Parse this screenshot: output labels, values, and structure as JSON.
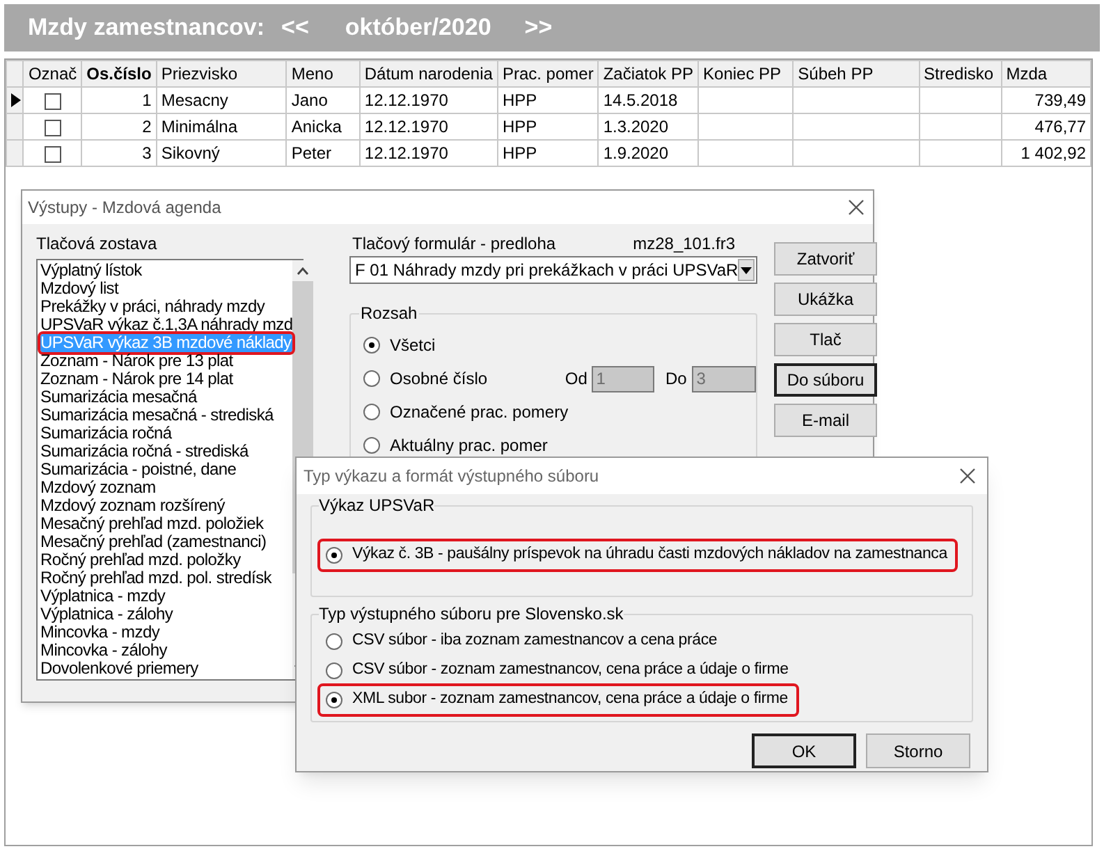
{
  "header": {
    "title": "Mzdy zamestnancov:",
    "prev": "<<",
    "period": "október/2020",
    "next": ">>"
  },
  "grid": {
    "columns": [
      {
        "label": "Označ",
        "sorted": false
      },
      {
        "label": "Os.číslo",
        "sorted": true
      },
      {
        "label": "Priezvisko",
        "sorted": false
      },
      {
        "label": "Meno",
        "sorted": false
      },
      {
        "label": "Dátum narodenia",
        "sorted": false
      },
      {
        "label": "Prac. pomer",
        "sorted": false
      },
      {
        "label": "Začiatok PP",
        "sorted": false
      },
      {
        "label": "Koniec PP",
        "sorted": false
      },
      {
        "label": "Súbeh PP",
        "sorted": false
      },
      {
        "label": "Stredisko",
        "sorted": false
      },
      {
        "label": "Mzda",
        "sorted": false
      }
    ],
    "rows": [
      {
        "selected": true,
        "checked": false,
        "number": "1",
        "surname": "Mesacny",
        "first_name": "Jano",
        "birth_date": "12.12.1970",
        "employment": "HPP",
        "start": "14.5.2018",
        "wage": "739,49"
      },
      {
        "selected": false,
        "checked": false,
        "number": "2",
        "surname": "Minimálna",
        "first_name": "Anicka",
        "birth_date": "12.12.1970",
        "employment": "HPP",
        "start": "1.3.2020",
        "wage": "476,77"
      },
      {
        "selected": false,
        "checked": false,
        "number": "3",
        "surname": "Sikovný",
        "first_name": "Peter",
        "birth_date": "12.12.1970",
        "employment": "HPP",
        "start": "1.9.2020",
        "wage": "1 402,92"
      }
    ]
  },
  "outputs_dialog": {
    "title": "Výstupy - Mzdová agenda",
    "report_label": "Tlačová zostava",
    "reports": [
      {
        "label": "Výplatný lístok",
        "selected": false,
        "highlighted": false
      },
      {
        "label": "Mzdový list",
        "selected": false,
        "highlighted": false
      },
      {
        "label": "Prekážky v práci, náhrady mzdy",
        "selected": false,
        "highlighted": false
      },
      {
        "label": "UPSVaR výkaz č.1,3A náhrady mzd",
        "selected": false,
        "highlighted": false
      },
      {
        "label": "UPSVaR výkaz 3B mzdové náklady",
        "selected": true,
        "highlighted": true
      },
      {
        "label": "Zoznam - Nárok pre 13 plat",
        "selected": false,
        "highlighted": false
      },
      {
        "label": "Zoznam - Nárok pre 14 plat",
        "selected": false,
        "highlighted": false
      },
      {
        "label": "Sumarizácia mesačná",
        "selected": false,
        "highlighted": false
      },
      {
        "label": "Sumarizácia mesačná - strediská",
        "selected": false,
        "highlighted": false
      },
      {
        "label": "Sumarizácia ročná",
        "selected": false,
        "highlighted": false
      },
      {
        "label": "Sumarizácia ročná - strediská",
        "selected": false,
        "highlighted": false
      },
      {
        "label": "Sumarizácia - poistné, dane",
        "selected": false,
        "highlighted": false
      },
      {
        "label": "Mzdový zoznam",
        "selected": false,
        "highlighted": false
      },
      {
        "label": "Mzdový zoznam rozšírený",
        "selected": false,
        "highlighted": false
      },
      {
        "label": "Mesačný prehľad mzd. položiek",
        "selected": false,
        "highlighted": false
      },
      {
        "label": "Mesačný prehľad (zamestnanci)",
        "selected": false,
        "highlighted": false
      },
      {
        "label": "Ročný prehľad mzd. položky",
        "selected": false,
        "highlighted": false
      },
      {
        "label": "Ročný prehľad mzd. pol. stredísk",
        "selected": false,
        "highlighted": false
      },
      {
        "label": "Výplatnica - mzdy",
        "selected": false,
        "highlighted": false
      },
      {
        "label": "Výplatnica - zálohy",
        "selected": false,
        "highlighted": false
      },
      {
        "label": "Mincovka - mzdy",
        "selected": false,
        "highlighted": false
      },
      {
        "label": "Mincovka - zálohy",
        "selected": false,
        "highlighted": false
      },
      {
        "label": "Dovolenkové priemery",
        "selected": false,
        "highlighted": false
      }
    ],
    "form_label": "Tlačový formulár - predloha",
    "form_file": "mz28_101.fr3",
    "form_value": "F 01 Náhrady mzdy pri prekážkach v práci UPSVaR",
    "range": {
      "label": "Rozsah",
      "options": [
        {
          "label": "Všetci",
          "selected": true,
          "kind": "plain"
        },
        {
          "label": "Osobné číslo",
          "selected": false,
          "kind": "range"
        },
        {
          "label": "Označené prac. pomery",
          "selected": false,
          "kind": "plain"
        },
        {
          "label": "Aktuálny prac. pomer",
          "selected": false,
          "kind": "plain"
        }
      ],
      "from_label": "Od",
      "from": "1",
      "to_label": "Do",
      "to": "3",
      "disabled": true
    },
    "buttons": [
      {
        "label": "Zatvoriť",
        "default": false
      },
      {
        "label": "Ukážka",
        "default": false
      },
      {
        "label": "Tlač",
        "default": false
      },
      {
        "label": "Do súboru",
        "default": true
      },
      {
        "label": "E-mail",
        "default": false
      }
    ]
  },
  "format_dialog": {
    "title": "Typ výkazu a formát výstupného súboru",
    "groups": [
      {
        "label": "Výkaz UPSVaR",
        "options": [
          {
            "label": "Výkaz č. 3B - paušálny príspevok na úhradu časti mzdových nákladov na zamestnanca",
            "selected": true,
            "highlighted": true
          }
        ]
      },
      {
        "label": "Typ výstupného súboru pre Slovensko.sk",
        "options": [
          {
            "label": "CSV súbor - iba zoznam zamestnancov a cena práce",
            "selected": false,
            "highlighted": false
          },
          {
            "label": "CSV súbor - zoznam zamestnancov, cena práce a údaje o firme",
            "selected": false,
            "highlighted": false
          },
          {
            "label": "XML subor - zoznam zamestnancov, cena práce a údaje o firme",
            "selected": true,
            "highlighted": true
          }
        ]
      }
    ],
    "buttons": [
      {
        "label": "OK",
        "default": true
      },
      {
        "label": "Storno",
        "default": false
      }
    ]
  }
}
